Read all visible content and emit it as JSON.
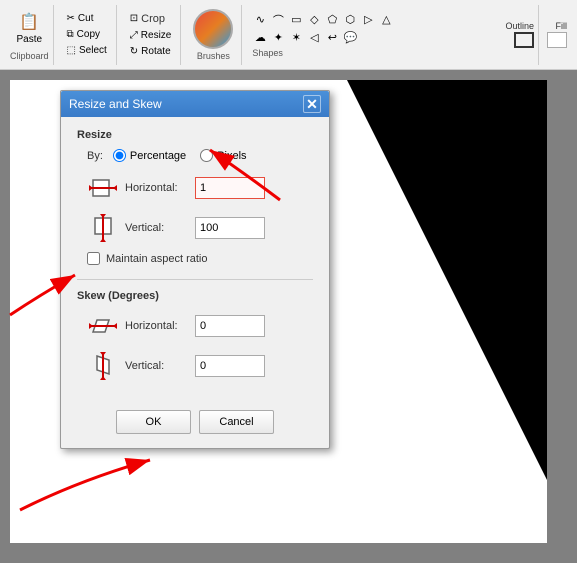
{
  "toolbar": {
    "clipboard_label": "Clipboard",
    "paste_label": "Paste",
    "cut_label": "Cut",
    "copy_label": "Copy",
    "select_label": "Select",
    "crop_label": "Crop",
    "resize_label": "Resize",
    "rotate_label": "Rotate",
    "brushes_label": "Brushes",
    "shapes_label": "Shapes",
    "outline_label": "Outline",
    "fill_label": "Fill"
  },
  "dialog": {
    "title": "Resize and Skew",
    "close_label": "✕",
    "resize_section": "Resize",
    "by_label": "By:",
    "percentage_label": "Percentage",
    "pixels_label": "Pixels",
    "horizontal_label": "Horizontal:",
    "horizontal_value": "1",
    "vertical_label": "Vertical:",
    "vertical_value": "100",
    "maintain_aspect_label": "Maintain aspect ratio",
    "skew_section": "Skew (Degrees)",
    "skew_horizontal_label": "Horizontal:",
    "skew_horizontal_value": "0",
    "skew_vertical_label": "Vertical:",
    "skew_vertical_value": "0",
    "ok_label": "OK",
    "cancel_label": "Cancel"
  }
}
